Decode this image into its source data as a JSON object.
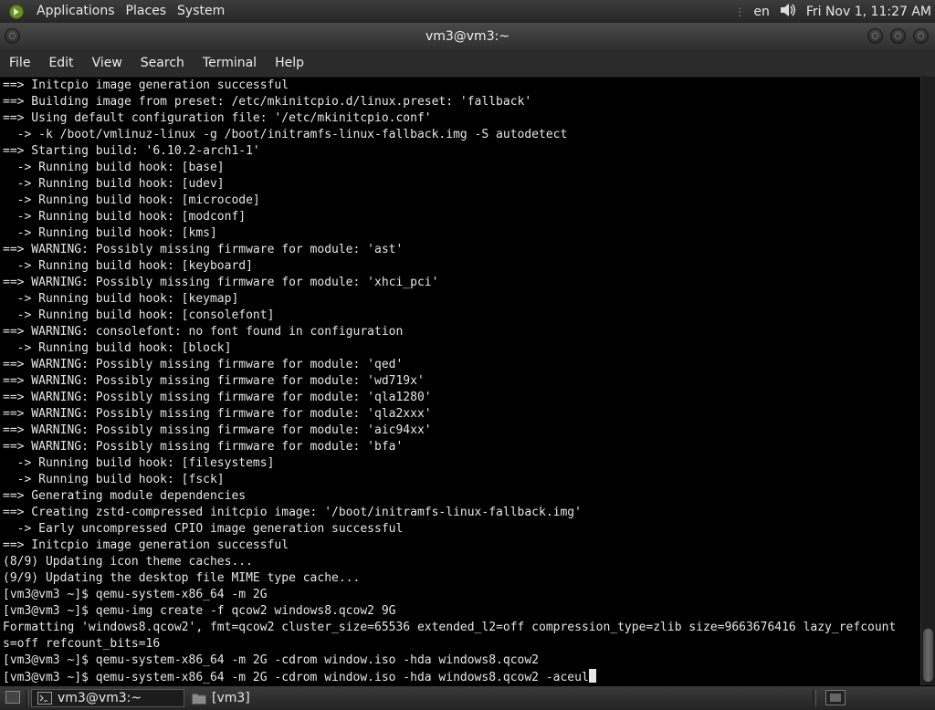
{
  "top_panel": {
    "menus": [
      "Applications",
      "Places",
      "System"
    ],
    "keyboard_layout": "en",
    "datetime": "Fri Nov 1, 11:27 AM"
  },
  "window": {
    "title": "vm3@vm3:~"
  },
  "menubar": {
    "items": [
      "File",
      "Edit",
      "View",
      "Search",
      "Terminal",
      "Help"
    ]
  },
  "terminal": {
    "lines": [
      "==> Initcpio image generation successful",
      "==> Building image from preset: /etc/mkinitcpio.d/linux.preset: 'fallback'",
      "==> Using default configuration file: '/etc/mkinitcpio.conf'",
      "  -> -k /boot/vmlinuz-linux -g /boot/initramfs-linux-fallback.img -S autodetect",
      "==> Starting build: '6.10.2-arch1-1'",
      "  -> Running build hook: [base]",
      "  -> Running build hook: [udev]",
      "  -> Running build hook: [microcode]",
      "  -> Running build hook: [modconf]",
      "  -> Running build hook: [kms]",
      "==> WARNING: Possibly missing firmware for module: 'ast'",
      "  -> Running build hook: [keyboard]",
      "==> WARNING: Possibly missing firmware for module: 'xhci_pci'",
      "  -> Running build hook: [keymap]",
      "  -> Running build hook: [consolefont]",
      "==> WARNING: consolefont: no font found in configuration",
      "  -> Running build hook: [block]",
      "==> WARNING: Possibly missing firmware for module: 'qed'",
      "==> WARNING: Possibly missing firmware for module: 'wd719x'",
      "==> WARNING: Possibly missing firmware for module: 'qla1280'",
      "==> WARNING: Possibly missing firmware for module: 'qla2xxx'",
      "==> WARNING: Possibly missing firmware for module: 'aic94xx'",
      "==> WARNING: Possibly missing firmware for module: 'bfa'",
      "  -> Running build hook: [filesystems]",
      "  -> Running build hook: [fsck]",
      "==> Generating module dependencies",
      "==> Creating zstd-compressed initcpio image: '/boot/initramfs-linux-fallback.img'",
      "  -> Early uncompressed CPIO image generation successful",
      "==> Initcpio image generation successful",
      "(8/9) Updating icon theme caches...",
      "(9/9) Updating the desktop file MIME type cache...",
      "[vm3@vm3 ~]$ qemu-system-x86_64 -m 2G",
      "[vm3@vm3 ~]$ qemu-img create -f qcow2 windows8.qcow2 9G",
      "Formatting 'windows8.qcow2', fmt=qcow2 cluster_size=65536 extended_l2=off compression_type=zlib size=9663676416 lazy_refcount",
      "s=off refcount_bits=16",
      "[vm3@vm3 ~]$ qemu-system-x86_64 -m 2G -cdrom window.iso -hda windows8.qcow2",
      "[vm3@vm3 ~]$ qemu-system-x86_64 -m 2G -cdrom window.iso -hda windows8.qcow2 -aceul"
    ]
  },
  "taskbar": {
    "tasks": [
      {
        "label": "vm3@vm3:~",
        "icon": "terminal-icon",
        "active": true
      },
      {
        "label": "[vm3]",
        "icon": "folder-icon",
        "active": false
      }
    ]
  }
}
